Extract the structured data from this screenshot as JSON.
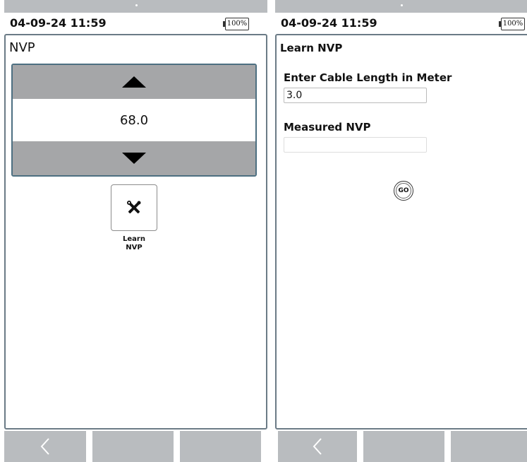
{
  "left_screen": {
    "status": {
      "time": "04-09-24 11:59",
      "battery": "100%"
    },
    "panel_title": "NVP",
    "stepper": {
      "value": "68.0",
      "up_icon": "triangle-up-icon",
      "down_icon": "triangle-down-icon"
    },
    "learn_button": {
      "icon": "tools-icon",
      "label_line1": "Learn",
      "label_line2": "NVP"
    },
    "navbar": {
      "back_icon": "chevron-left-icon"
    }
  },
  "right_screen": {
    "status": {
      "time": "04-09-24 11:59",
      "battery": "100%"
    },
    "panel_title": "Learn NVP",
    "cable_length": {
      "label": "Enter Cable Length in Meter",
      "value": "3.0"
    },
    "measured_nvp": {
      "label": "Measured NVP",
      "value": ""
    },
    "go_button": {
      "label": "GO"
    },
    "navbar": {
      "back_icon": "chevron-left-icon"
    }
  },
  "colors": {
    "nav_gray": "#b9bcbf",
    "stepper_gray": "#a5a6a8",
    "panel_border": "#6b7b86"
  }
}
